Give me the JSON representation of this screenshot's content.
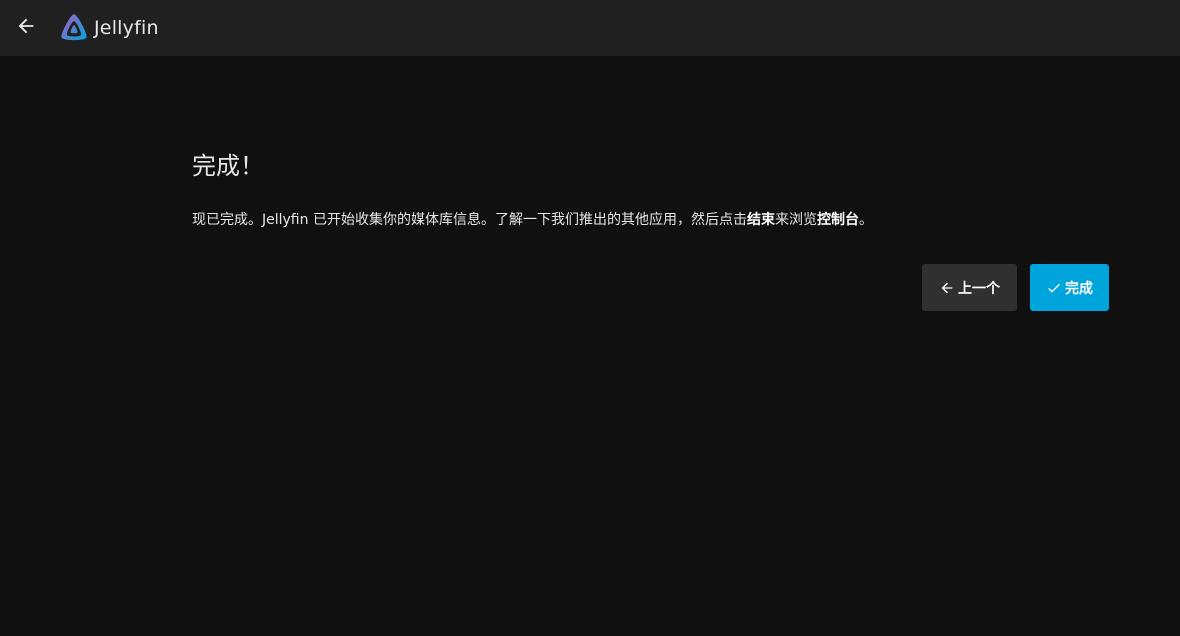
{
  "header": {
    "back_icon": "arrow-left-icon",
    "logo_icon": "jellyfin-logo-icon",
    "app_name": "Jellyfin",
    "colors": {
      "background": "#202020",
      "logo_gradient_start": "#aa5cc3",
      "logo_gradient_end": "#00a4dc"
    }
  },
  "main": {
    "title": "完成！",
    "description": {
      "text_1": "现已完成。Jellyfin 已开始收集你的媒体库信息。了解一下我们推出的其他应用，然后点击",
      "bold_1": "结束",
      "text_2": "来浏览",
      "bold_2": "控制台",
      "text_3": "。"
    },
    "buttons": {
      "previous": {
        "label": "上一个",
        "icon": "arrow-left-icon"
      },
      "finish": {
        "label": "完成",
        "icon": "check-icon"
      }
    },
    "colors": {
      "background": "#101010",
      "accent": "#00a4dc",
      "secondary_button": "#303030"
    }
  }
}
